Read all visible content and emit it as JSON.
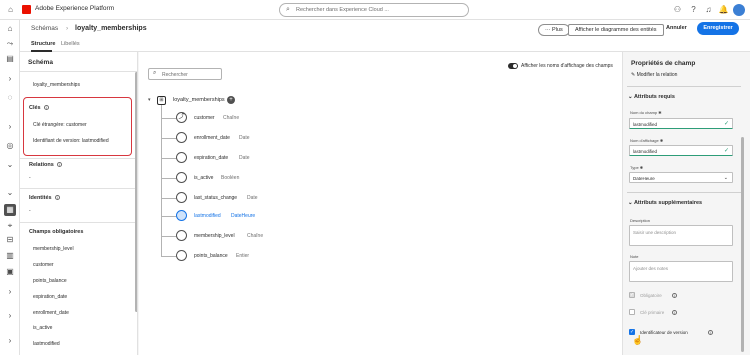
{
  "topbar": {
    "brand": "Adobe Experience Platform",
    "search_placeholder": "Rechercher dans Experience Cloud ..."
  },
  "header": {
    "breadcrumb_root": "Schémas",
    "breadcrumb_sep": "›",
    "title": "loyalty_memberships",
    "tabs": [
      {
        "label": "Structure"
      },
      {
        "label": "Libellés"
      }
    ],
    "more_button": "··· Plus",
    "diagram_button": "Afficher le diagramme des entités",
    "cancel_button": "Annuler",
    "save_button": "Enregistrer"
  },
  "left_panel": {
    "title": "Schéma",
    "schema_name": "loyalty_memberships",
    "keys": {
      "heading": "Clés",
      "items": [
        "Clé étrangère: customer",
        "Identifiant de version: lastmodified"
      ]
    },
    "relations": {
      "heading": "Relations",
      "value": "-"
    },
    "identities": {
      "heading": "Identités",
      "value": "-"
    },
    "required": {
      "heading": "Champs obligatoires",
      "items": [
        "membership_level",
        "customer",
        "points_balance",
        "expiration_date",
        "enrollment_date",
        "is_active",
        "lastmodified"
      ]
    }
  },
  "canvas": {
    "search_placeholder": "Rechercher",
    "toggle_label": "Afficher les noms d'affichage des champs",
    "root": "loyalty_memberships",
    "fields": [
      {
        "name": "customer",
        "type": "Chaîne"
      },
      {
        "name": "enrollment_date",
        "type": "Date"
      },
      {
        "name": "expiration_date",
        "type": "Date"
      },
      {
        "name": "is_active",
        "type": "Booléen"
      },
      {
        "name": "last_status_change",
        "type": "Date"
      },
      {
        "name": "lastmodified",
        "type": "DateHeure"
      },
      {
        "name": "membership_level",
        "type": "Chaîne"
      },
      {
        "name": "points_balance",
        "type": "Entier"
      }
    ]
  },
  "right_panel": {
    "title": "Propriétés de champ",
    "modify_relation": "Modifier la relation",
    "required_section": "Attributs requis",
    "field_name_label": "Nom du champ",
    "field_name_value": "lastmodified",
    "display_name_label": "Nom d'affichage",
    "display_name_value": "lastmodified",
    "type_label": "Type",
    "type_value": "DateHeure",
    "additional_section": "Attributs supplémentaires",
    "description_label": "Description",
    "description_placeholder": "Saisir une description",
    "note_label": "Note",
    "note_placeholder": "Ajouter des notes",
    "checkbox_required": "Obligatoire",
    "checkbox_primary_key": "Clé primaire",
    "checkbox_version_id": "Identificateur de version"
  },
  "colors": {
    "accent": "#1473e6",
    "highlight_border": "#d7373f",
    "valid": "#2d9d78"
  }
}
